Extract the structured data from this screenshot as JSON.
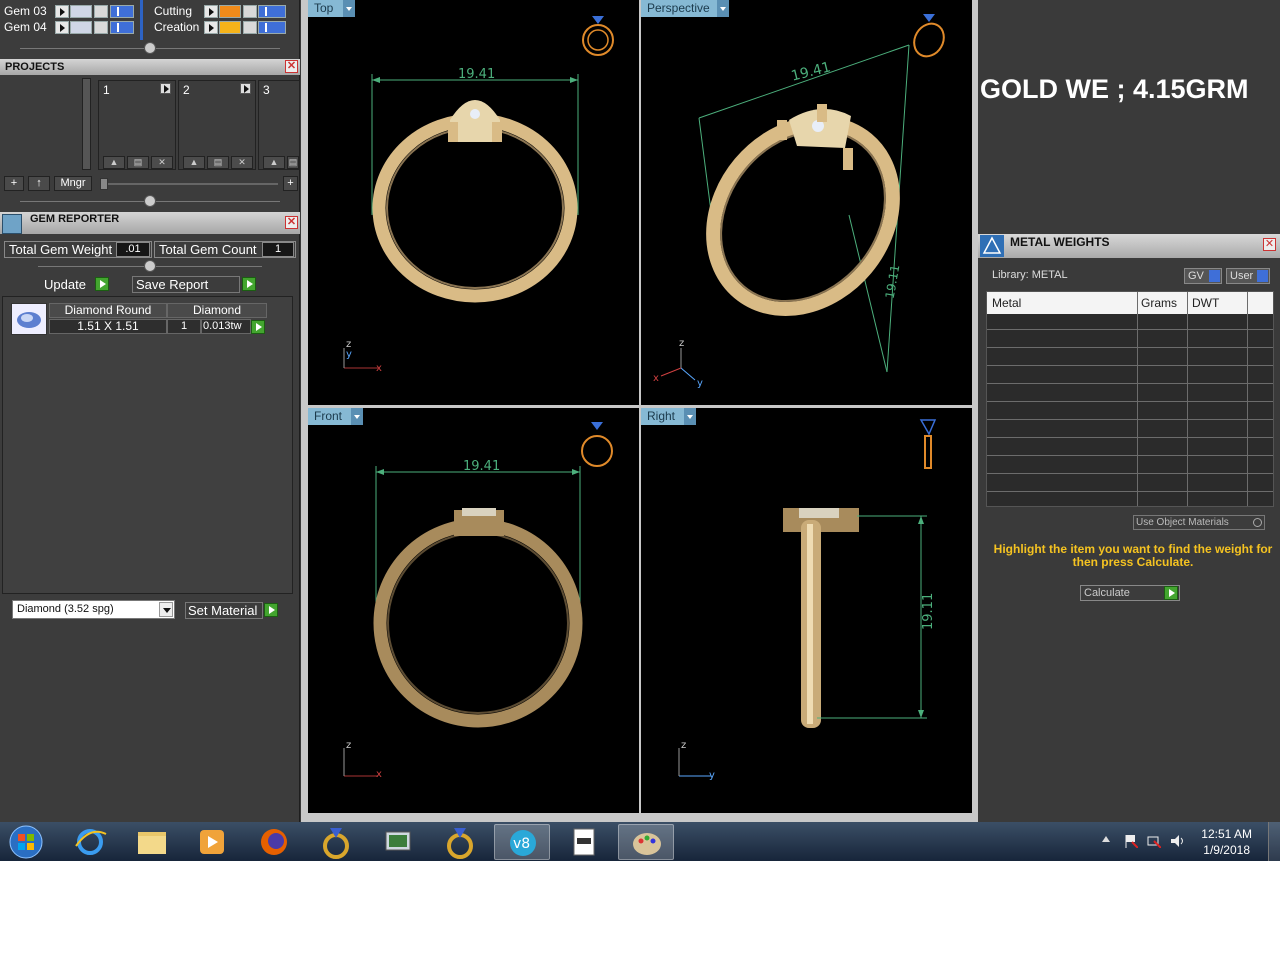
{
  "layers": [
    {
      "name": "Gem 03",
      "color": "#cfd6e6"
    },
    {
      "name": "Gem 04",
      "color": "#cfd6e6"
    },
    {
      "name": "Cutting",
      "color": "#f08a1a"
    },
    {
      "name": "Creation",
      "color": "#f5b31a"
    }
  ],
  "projects": {
    "title": "PROJECTS",
    "slots": [
      "1",
      "2",
      "3"
    ],
    "mngr_label": "Mngr"
  },
  "gem_reporter": {
    "title": "GEM REPORTER",
    "total_weight_label": "Total Gem Weight",
    "total_weight_value": ".01",
    "total_count_label": "Total Gem Count",
    "total_count_value": "1",
    "update_label": "Update",
    "save_report_label": "Save Report",
    "gem_table": {
      "headers": [
        "Diamond Round",
        "Diamond"
      ],
      "row": {
        "size": "1.51 X 1.51",
        "count": "1",
        "weight": "0.013tw"
      }
    },
    "material_select": "Diamond    (3.52 spg)",
    "set_material_label": "Set Material"
  },
  "viewports": {
    "top": {
      "label": "Top",
      "dimension": "19.41"
    },
    "perspective": {
      "label": "Perspective",
      "dimension_width": "19.41",
      "dimension_height": "19.11"
    },
    "front": {
      "label": "Front",
      "dimension": "19.41"
    },
    "right": {
      "label": "Right",
      "dimension": "19.11"
    },
    "axis": {
      "x": "x",
      "y": "y",
      "z": "z"
    }
  },
  "annotation": "GOLD WE ; 4.15GRM",
  "metal_weights": {
    "title": "METAL WEIGHTS",
    "library_label": "Library: METAL",
    "gv_label": "GV",
    "user_label": "User",
    "columns": [
      "Metal",
      "Grams",
      "DWT"
    ],
    "use_object_materials": "Use Object Materials",
    "hint": "Highlight the item you want to find the weight for then press Calculate.",
    "calculate_label": "Calculate"
  },
  "taskbar": {
    "time": "12:51 AM",
    "date": "1/9/2018",
    "items": [
      "start-orb",
      "internet-explorer",
      "file-explorer",
      "media-player",
      "firefox",
      "gem-app-1",
      "remote-desktop",
      "gem-app-2",
      "v8-app",
      "document-viewer",
      "paint-app"
    ]
  },
  "colors": {
    "ring_gold": "#d9bb86",
    "dimension_line": "#4caf7c",
    "viewport_tab": "#86b9d4",
    "hint_yellow": "#f5c321",
    "play_green": "#43a52f"
  }
}
